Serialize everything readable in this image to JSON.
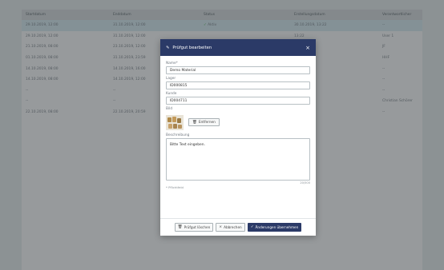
{
  "table": {
    "headers": [
      "Startdatum",
      "Enddatum",
      "Status",
      "Erstellungsdatum",
      "Verantwortlicher"
    ],
    "rows": [
      [
        "29.10.2019, 12:00",
        "31.10.2019, 12:00",
        "Aktiv",
        "30.10.2019, 13:22",
        "--"
      ],
      [
        "29.10.2019, 12:00",
        "31.10.2019, 12:00",
        "",
        "13:22",
        "User 1"
      ],
      [
        "21.10.2019, 08:00",
        "23.10.2019, 12:00",
        "",
        "14:32",
        "JF"
      ],
      [
        "01.10.2019, 08:00",
        "31.10.2019, 23:59",
        "",
        "15:10",
        "HHF"
      ],
      [
        "14.10.2019, 08:00",
        "14.10.2019, 16:00",
        "",
        "15:30",
        "--"
      ],
      [
        "14.10.2019, 08:00",
        "14.10.2019, 12:00",
        "",
        "11:33",
        "--"
      ],
      [
        "--",
        "--",
        "",
        "11:25",
        "--"
      ],
      [
        "--",
        "--",
        "",
        "10:42",
        "Christian Schörer"
      ],
      [
        "22.10.2019, 08:00",
        "22.10.2019, 20:59",
        "",
        "17:40",
        "--"
      ]
    ],
    "status_icon": "check-circle-icon"
  },
  "modal": {
    "title": "Prüfgut bearbeiten",
    "close_label": "×",
    "fields": {
      "name_label": "Name*",
      "name_value": "Demo Material",
      "lager_label": "Lager",
      "lager_value": "ID000815",
      "kunde_label": "Kunde",
      "kunde_value": "ID004711",
      "bild_label": "Bild",
      "remove_label": "Entfernen",
      "desc_label": "Beschreibung",
      "desc_value": "Bitte Text eingeben.",
      "char_count": "20/500",
      "required_hint": "* Pflichtfeld"
    },
    "buttons": {
      "delete": "Prüfgut löschen",
      "cancel": "Abbrechen",
      "apply": "Änderungen übernehmen"
    }
  },
  "colors": {
    "primary": "#2b3a67",
    "status_green": "#4caf50"
  }
}
